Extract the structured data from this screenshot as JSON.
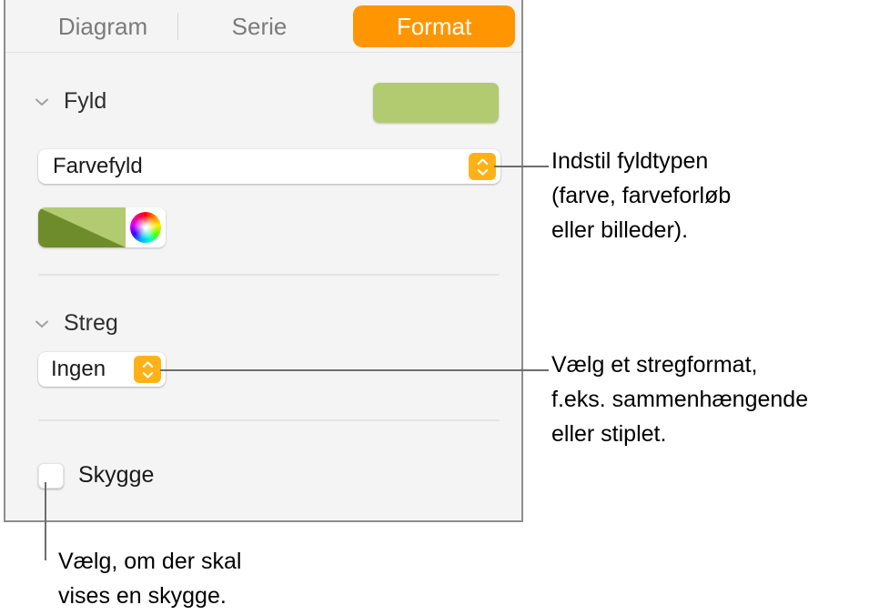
{
  "panel": {
    "tabs": [
      {
        "id": "diagram",
        "label": "Diagram",
        "selected": false
      },
      {
        "id": "serie",
        "label": "Serie",
        "selected": false
      },
      {
        "id": "format",
        "label": "Format",
        "selected": true
      }
    ],
    "accent_color": "#ff9500",
    "stepper_color": "#ffb218",
    "background_color": "#f4f4f4"
  },
  "fill_section": {
    "title": "Fyld",
    "disclosure_icon": "chevron-down-icon",
    "expanded": true,
    "preview_color": "#b2cb71",
    "fill_type": {
      "value": "Farvefyld",
      "stepper_icon": "chevron-up-down-icon"
    },
    "color_control": {
      "swatch_color_light": "#b2cb71",
      "swatch_color_dark": "#6e8c2c",
      "wheel_icon": "color-wheel-icon"
    }
  },
  "line_section": {
    "title": "Streg",
    "disclosure_icon": "chevron-down-icon",
    "expanded": true,
    "line_style": {
      "value": "Ingen",
      "stepper_icon": "chevron-up-down-icon"
    }
  },
  "shadow_section": {
    "label": "Skygge",
    "checked": false
  },
  "callouts": [
    {
      "id": "fill",
      "text": "Indstil fyldtypen\n(farve, farveforløb\neller billeder)."
    },
    {
      "id": "line",
      "text": "Vælg et stregformat,\nf.eks. sammenhængende\neller stiplet."
    },
    {
      "id": "shadow",
      "text": "Vælg, om der skal\nvises en skygge."
    }
  ]
}
